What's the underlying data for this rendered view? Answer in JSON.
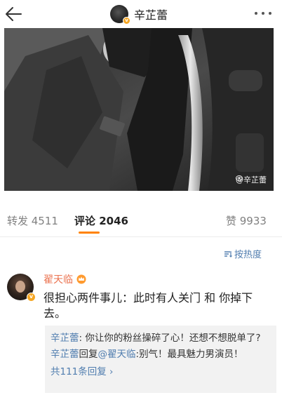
{
  "header": {
    "username": "辛芷蕾",
    "back_icon": "arrow-left-icon",
    "more_icon": "more-dots-icon"
  },
  "post": {
    "watermark": "@辛芷蕾"
  },
  "tabs": {
    "repost": "转发 4511",
    "comments": "评论 2046",
    "likes": "赞 9933"
  },
  "sort_label": "按热度",
  "colors": {
    "accent": "#ff8200",
    "link": "#507daf",
    "commenter_name": "#eb7350",
    "verified_badge": "#f5a623"
  },
  "comment": {
    "author": "翟天临",
    "text": "很担心两件事儿：此时有人关门 和 你掉下去。",
    "replies": [
      {
        "author": "辛芷蕾",
        "sep": ": ",
        "text": "你让你的粉丝操碎了心！还想不想脱单了?"
      },
      {
        "author": "辛芷蕾",
        "mid": "回复",
        "mention": "@翟天临",
        "sep": ":",
        "text": "别气！最具魅力男演员！"
      }
    ],
    "more_replies": "共111条回复 ›"
  }
}
